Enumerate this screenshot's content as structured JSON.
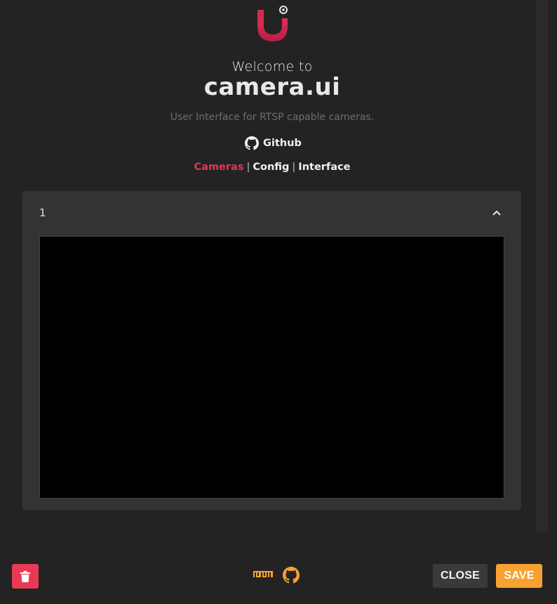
{
  "header": {
    "welcome": "Welcome to",
    "brand": "camera.ui",
    "tagline": "User Interface for RTSP capable cameras.",
    "github_label": "Github"
  },
  "nav": {
    "items": [
      {
        "label": "Cameras",
        "active": true
      },
      {
        "label": "Config",
        "active": false
      },
      {
        "label": "Interface",
        "active": false
      }
    ],
    "separator": "|"
  },
  "panel": {
    "title": "1",
    "expanded": true
  },
  "footer": {
    "close_label": "CLOSE",
    "save_label": "SAVE",
    "icons": [
      "npm-icon",
      "github-icon",
      "trash-icon"
    ]
  },
  "colors": {
    "accent": "#e4345b",
    "save": "#f7a230",
    "delete": "#e83a55",
    "background": "#232323",
    "panel": "#333333"
  }
}
